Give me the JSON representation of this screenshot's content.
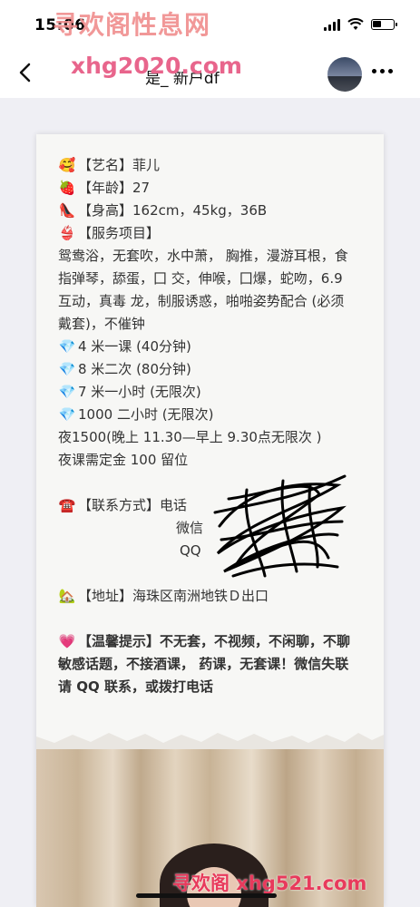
{
  "status": {
    "time": "15:06",
    "battery_level": 0.45
  },
  "nav": {
    "title": "是_ 新户df"
  },
  "watermarks": {
    "top": "寻欢阁性息网",
    "top2": "xhg2020.com",
    "bottom": "寻欢阁 xhg521.com"
  },
  "post": {
    "name_line": "【艺名】菲儿",
    "age_line": "【年龄】27",
    "height_line": "【身高】162cm，45kg，36B",
    "services_head": "【服务项目】",
    "services_text": "鸳鸯浴，无套吹，水中萧， 胸推，漫游耳根，食指弹琴，舔蛋，囗 交，伸喉，囗爆，蛇吻，6.9 互动，真毒 龙，制服诱惑，啪啪姿势配合 (必须戴套)，不催钟",
    "price1": "4 米一课 (40分钟)",
    "price2": "8 米二次 (80分钟)",
    "price3": "7 米一小时 (无限次)",
    "price4": "1000 二小时 (无限次)",
    "night": "夜1500(晚上 11.30—早上 9.30点无限次 )",
    "deposit": "夜课需定金 100 留位",
    "contact_head": "【联系方式】电话",
    "wechat": "微信",
    "qq": "QQ",
    "address": "【地址】海珠区南洲地铁Ｄ出口",
    "tip_head": "【温馨提示】",
    "tip_text": "不无套，不视频，不闲聊，不聊敏感话题，不接酒课， 药课，无套课！微信失联请 QQ 联系，或拨打电话"
  },
  "icons": {
    "name": "smiling-face-with-hearts",
    "age": "strawberry",
    "height": "high-heel",
    "services": "bikini",
    "price": "gem",
    "contact": "telephone",
    "address": "house-with-garden",
    "tip": "sparkling-heart"
  },
  "colors": {
    "watermark_pink": "#e83a5c",
    "card_bg": "#f7f7f5",
    "page_bg": "#efeff4"
  }
}
